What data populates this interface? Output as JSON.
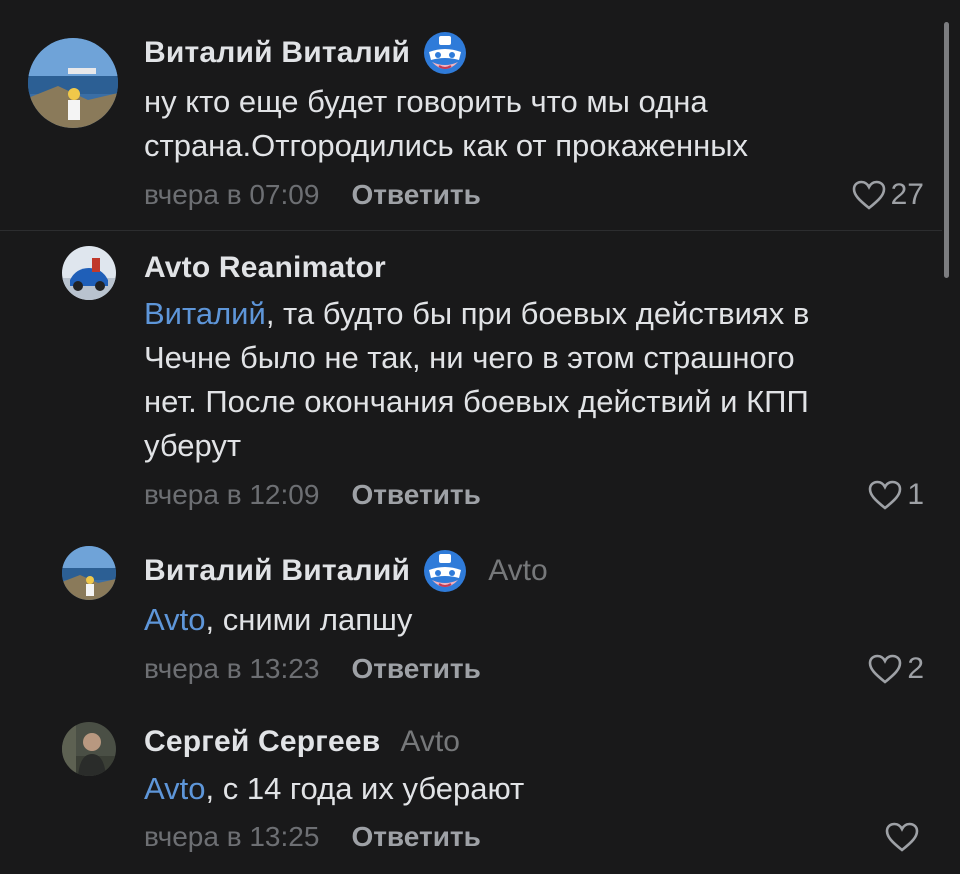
{
  "comments": [
    {
      "author": "Виталий Виталий",
      "badge": "captain-mask-icon",
      "reply_to": "",
      "mention": "",
      "text_lines": [
        "ну кто еще будет говорить что мы одна",
        "страна.Отгородились как от прокаженных"
      ],
      "time": "вчера в 07:09",
      "reply_label": "Ответить",
      "likes": "27"
    },
    {
      "author": "Avto Reanimator",
      "badge": "",
      "reply_to": "",
      "mention": "Виталий",
      "text_lines": [
        ", та будто бы при боевых действиях в",
        "Чечне было не так, ни чего в этом страшного",
        "нет. После окончания боевых действий и КПП",
        "уберут"
      ],
      "time": "вчера в 12:09",
      "reply_label": "Ответить",
      "likes": "1"
    },
    {
      "author": "Виталий Виталий",
      "badge": "captain-mask-icon",
      "reply_to": "Avto",
      "mention": "Avto",
      "text_lines": [
        ", сними лапшу"
      ],
      "time": "вчера в 13:23",
      "reply_label": "Ответить",
      "likes": "2"
    },
    {
      "author": "Сергей Сергеев",
      "badge": "",
      "reply_to": "Avto",
      "mention": "Avto",
      "text_lines": [
        ", с 14 года их уберают"
      ],
      "time": "вчера в 13:25",
      "reply_label": "Ответить",
      "likes": ""
    }
  ],
  "colors": {
    "background": "#19191a",
    "text": "#e1e3e6",
    "mention": "#5e96d9",
    "muted": "#6d6f73"
  }
}
